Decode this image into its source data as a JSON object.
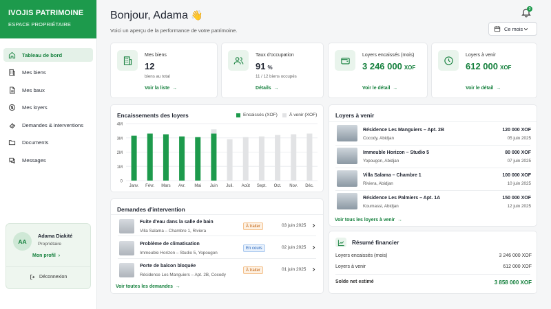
{
  "brand": {
    "title": "IVOJIS PATRIMOINE",
    "subtitle": "ESPACE PROPRIÉTAIRE"
  },
  "nav": [
    {
      "label": "Tableau de bord",
      "icon": "home-icon",
      "active": true
    },
    {
      "label": "Mes biens",
      "icon": "building-icon"
    },
    {
      "label": "Mes baux",
      "icon": "document-icon"
    },
    {
      "label": "Mes loyers",
      "icon": "dollar-icon"
    },
    {
      "label": "Demandes & interventions",
      "icon": "wrench-icon"
    },
    {
      "label": "Documents",
      "icon": "folder-icon"
    },
    {
      "label": "Messages",
      "icon": "chat-icon"
    }
  ],
  "profile": {
    "initials": "AA",
    "name": "Adama Diakité",
    "role": "Propriétaire",
    "link": "Mon profil",
    "logout": "Déconnexion"
  },
  "header": {
    "greeting": "Bonjour, Adama",
    "wave": "👋",
    "subtitle": "Voici un aperçu de la performance de votre patrimoine.",
    "notifications": "3",
    "period": "Ce mois"
  },
  "kpis": [
    {
      "label": "Mes biens",
      "value": "12",
      "unit": "",
      "sub": "biens au total",
      "link": "Voir la liste",
      "icon": "building-icon",
      "green": false
    },
    {
      "label": "Taux d'occupation",
      "value": "91",
      "unit": "%",
      "sub": "11 / 12 biens occupés",
      "link": "Détails",
      "icon": "users-icon",
      "green": false
    },
    {
      "label": "Loyers encaissés (mois)",
      "value": "3 246 000",
      "unit": "XOF",
      "sub": "",
      "link": "Voir le détail",
      "icon": "wallet-icon",
      "green": true
    },
    {
      "label": "Loyers à venir",
      "value": "612 000",
      "unit": "XOF",
      "sub": "",
      "link": "Voir le détail",
      "icon": "clock-icon",
      "green": true
    }
  ],
  "chart_data": {
    "type": "bar",
    "title": "Encaissements des loyers",
    "categories": [
      "Janv.",
      "Févr.",
      "Mars",
      "Avr.",
      "Mai",
      "Juin",
      "Juil.",
      "Août",
      "Sept.",
      "Oct.",
      "Nov.",
      "Déc."
    ],
    "series": [
      {
        "name": "Encaissés (XOF)",
        "color": "#1d9a4c",
        "values": [
          3.15,
          3.3,
          3.25,
          3.1,
          3.05,
          3.3,
          0,
          0,
          0,
          0,
          0,
          0
        ]
      },
      {
        "name": "À venir (XOF)",
        "color": "#e2e3e5",
        "values": [
          0,
          0,
          0,
          0,
          0,
          0.3,
          2.9,
          3.05,
          3.1,
          3.2,
          3.25,
          3.3
        ]
      }
    ],
    "stacked": true,
    "yticks": [
      "0",
      "1M",
      "2M",
      "3M",
      "4M"
    ],
    "ylim": [
      0,
      4
    ],
    "grid": true,
    "legend": "top-right"
  },
  "requests": {
    "title": "Demandes d'intervention",
    "items": [
      {
        "title": "Fuite d'eau dans la salle de bain",
        "sub": "Villa Salama – Chambre 1, Riviera",
        "status": "À traiter",
        "status_color": "orange",
        "date": "03 juin 2025"
      },
      {
        "title": "Problème de climatisation",
        "sub": "Immeuble Horizon – Studio 5, Yopougon",
        "status": "En cours",
        "status_color": "blue",
        "date": "02 juin 2025"
      },
      {
        "title": "Porte de balcon bloquée",
        "sub": "Résidence Les Manguiers – Apt. 2B, Cocody",
        "status": "À traiter",
        "status_color": "orange",
        "date": "01 juin 2025"
      }
    ],
    "link": "Voir toutes les demandes"
  },
  "upcoming": {
    "title": "Loyers à venir",
    "items": [
      {
        "name": "Résidence Les Manguiers – Apt. 2B",
        "loc": "Cocody, Abidjan",
        "amount": "120 000 XOF",
        "date": "05 juin 2025"
      },
      {
        "name": "Immeuble Horizon – Studio 5",
        "loc": "Yopougon, Abidjan",
        "amount": "80 000 XOF",
        "date": "07 juin 2025"
      },
      {
        "name": "Villa Salama – Chambre 1",
        "loc": "Riviera, Abidjan",
        "amount": "100 000 XOF",
        "date": "10 juin 2025"
      },
      {
        "name": "Résidence Les Palmiers – Apt. 1A",
        "loc": "Koumassi, Abidjan",
        "amount": "150 000 XOF",
        "date": "12 juin 2025"
      }
    ],
    "link": "Voir tous les loyers à venir"
  },
  "summary": {
    "title": "Résumé financier",
    "rows": [
      {
        "label": "Loyers encaissés (mois)",
        "value": "3 246 000 XOF"
      },
      {
        "label": "Loyers à venir",
        "value": "612 000 XOF"
      }
    ],
    "total_label": "Solde net estimé",
    "total_value": "3 858 000 XOF"
  }
}
